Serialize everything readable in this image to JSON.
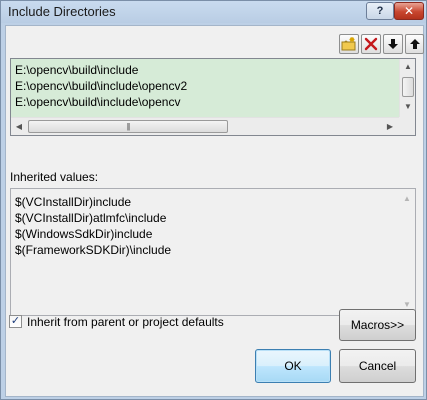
{
  "window": {
    "title": "Include Directories",
    "help_glyph": "?",
    "close_glyph": "✕"
  },
  "toolbar": {
    "icons": [
      "new-line-icon",
      "delete-icon",
      "move-down-icon",
      "move-up-icon"
    ]
  },
  "directories": [
    "E:\\opencv\\build\\include",
    "E:\\opencv\\build\\include\\opencv2",
    "E:\\opencv\\build\\include\\opencv"
  ],
  "inherited": {
    "label": "Inherited values:",
    "values": [
      "$(VCInstallDir)include",
      "$(VCInstallDir)atlmfc\\include",
      "$(WindowsSdkDir)include",
      "$(FrameworkSDKDir)\\include"
    ]
  },
  "inherit_checkbox": {
    "label": "Inherit from parent or project defaults",
    "checked": true,
    "glyph": "✓"
  },
  "buttons": {
    "macros": "Macros>>",
    "ok": "OK",
    "cancel": "Cancel"
  },
  "colors": {
    "list_highlight": "#d6ebd7",
    "title_bar": "#bdd0e6",
    "close_button": "#c8462f",
    "default_button": "#bee6fd"
  }
}
